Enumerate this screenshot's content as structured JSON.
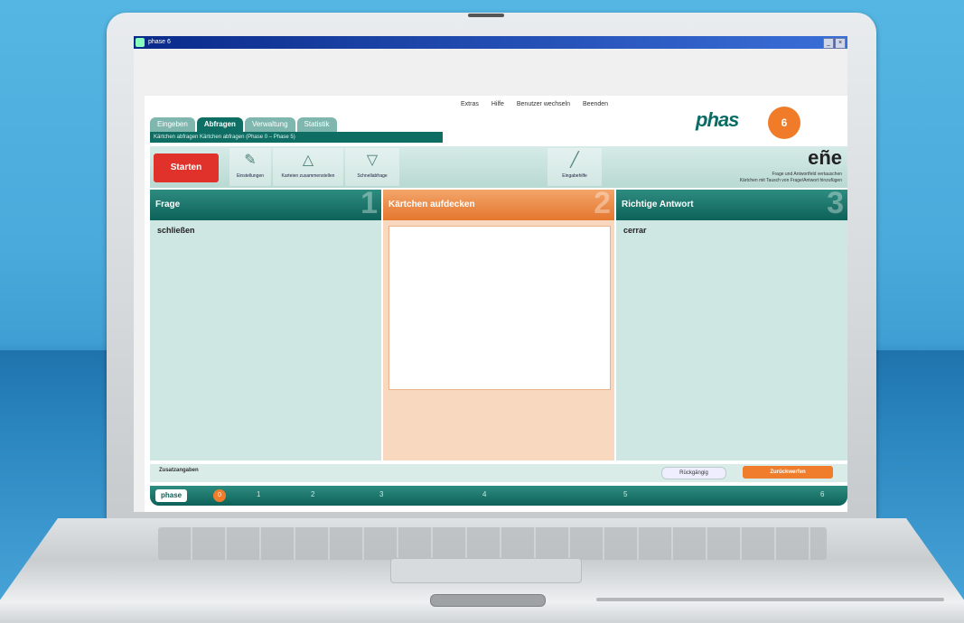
{
  "window": {
    "title": "phase 6"
  },
  "topmenu": [
    "Extras",
    "Hilfe",
    "Benutzer wechseln",
    "Beenden"
  ],
  "logo": {
    "text": "phas",
    "badge": "6"
  },
  "tabs": [
    {
      "label": "Eingeben",
      "active": false
    },
    {
      "label": "Abfragen",
      "active": true
    },
    {
      "label": "Verwaltung",
      "active": false
    },
    {
      "label": "Statistik",
      "active": false
    }
  ],
  "breadcrumb": "Kärtchen abfragen   Kärtchen abfragen (Phase 0 – Phase 5)",
  "toolbar": {
    "start_label": "Starten",
    "tools": [
      "Einstellungen",
      "Karteien zusammenstellen",
      "Schnellabfrage",
      "Eingabehilfe"
    ],
    "language_label": "eñe",
    "options": [
      "Frage und Antwortfeld vertauschen",
      "Kärtchen mit Tausch von Frage/Antwort hinzufügen"
    ]
  },
  "panels": [
    {
      "title": "Frage",
      "number": "1",
      "content": "schließen"
    },
    {
      "title": "Kärtchen aufdecken",
      "number": "2",
      "content": ""
    },
    {
      "title": "Richtige Antwort",
      "number": "3",
      "content": "cerrar"
    }
  ],
  "footer": {
    "zusatz_label": "Zusatzangaben",
    "back_label": "Rückgängig",
    "next_label": "Zurückwerfen"
  },
  "phasebar": {
    "label": "phase",
    "current": "0",
    "phases": [
      "1",
      "2",
      "3",
      "4",
      "5",
      "6"
    ]
  },
  "colors": {
    "accent": "#ef7d2b",
    "brand": "#0e6e64",
    "start": "#e0322a"
  }
}
